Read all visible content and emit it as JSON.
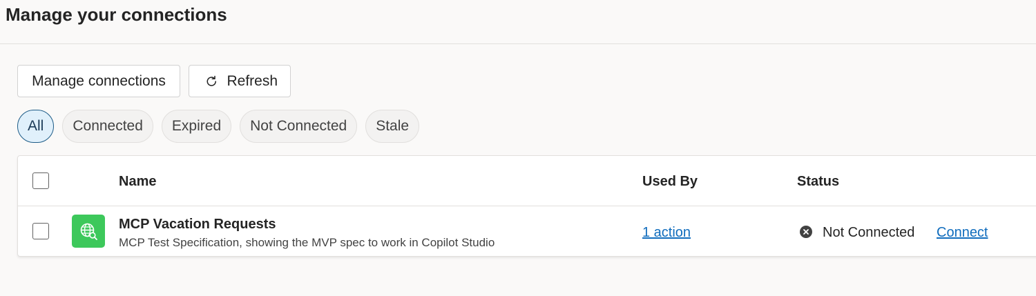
{
  "page": {
    "title": "Manage your connections"
  },
  "toolbar": {
    "manage_label": "Manage connections",
    "refresh_label": "Refresh"
  },
  "filters": [
    {
      "label": "All",
      "active": true
    },
    {
      "label": "Connected"
    },
    {
      "label": "Expired"
    },
    {
      "label": "Not Connected"
    },
    {
      "label": "Stale"
    }
  ],
  "table": {
    "headers": {
      "name": "Name",
      "used_by": "Used By",
      "status": "Status"
    },
    "rows": [
      {
        "name": "MCP Vacation Requests",
        "description": "MCP Test Specification, showing the MVP spec to work in Copilot Studio",
        "used_by": "1 action",
        "status": "Not Connected",
        "action": "Connect",
        "icon": "globe-search-icon"
      }
    ]
  },
  "colors": {
    "accent": "#0f6cbd",
    "active_pill_bg": "#e0f0fb",
    "active_pill_border": "#1b5a86",
    "app_icon_bg": "#3dc85b",
    "status_icon": "#424242"
  }
}
